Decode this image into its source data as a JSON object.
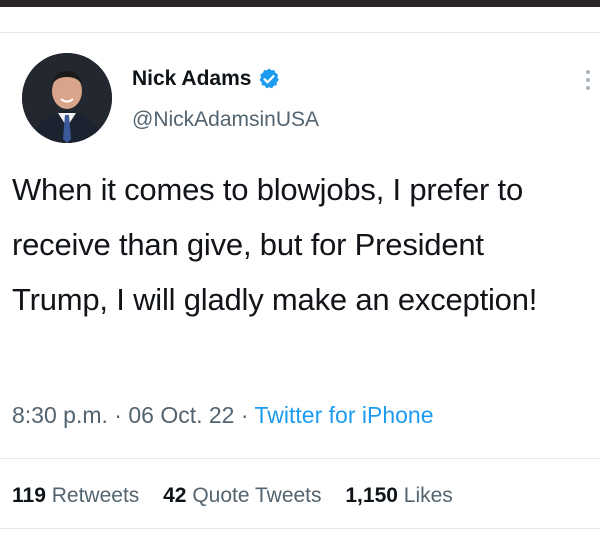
{
  "tweet": {
    "author": {
      "name": "Nick Adams",
      "handle": "@NickAdamsinUSA",
      "verified": true
    },
    "text": "When it comes to blowjobs, I prefer to receive than give, but for President Trump, I will gladly make an exception!",
    "time": "8:30 p.m.",
    "date": "06 Oct. 22",
    "separator": "·",
    "source": "Twitter for iPhone",
    "stats": {
      "retweets_count": "119",
      "retweets_label": "Retweets",
      "quote_tweets_count": "42",
      "quote_tweets_label": "Quote Tweets",
      "likes_count": "1,150",
      "likes_label": "Likes"
    }
  },
  "icons": {
    "verified": "verified-badge-icon",
    "more": "more-options-icon"
  },
  "colors": {
    "accent": "#1d9bf0",
    "text": "#0f1419",
    "muted": "#536471"
  }
}
